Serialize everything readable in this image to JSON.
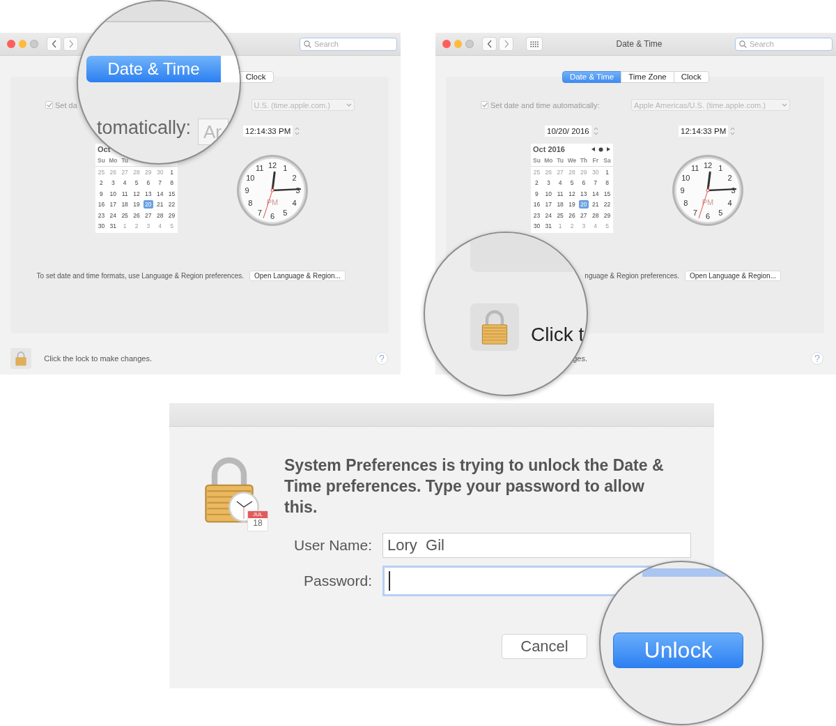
{
  "panels": [
    {
      "grid_button": false,
      "search": {
        "placeholder": "Search"
      },
      "tabs": [
        {
          "label": "Clock",
          "selected": false
        }
      ],
      "auto_set": {
        "checked": true,
        "label": "Set da",
        "server": "U.S. (time.apple.com.)"
      },
      "time": "12:14:33 PM",
      "calendar": {
        "month": "Oct",
        "nav": false,
        "weekdays": [
          "Su",
          "Mo",
          "Tu"
        ],
        "days": [
          {
            "day": "25",
            "outside": true,
            "selected": false
          },
          {
            "day": "26",
            "outside": true,
            "selected": false
          },
          {
            "day": "27",
            "outside": true,
            "selected": false
          },
          {
            "day": "28",
            "outside": true,
            "selected": false
          },
          {
            "day": "29",
            "outside": true,
            "selected": false
          },
          {
            "day": "30",
            "outside": true,
            "selected": false
          },
          {
            "day": "1",
            "outside": false,
            "selected": false
          },
          {
            "day": "2",
            "outside": false,
            "selected": false
          },
          {
            "day": "3",
            "outside": false,
            "selected": false
          },
          {
            "day": "4",
            "outside": false,
            "selected": false
          },
          {
            "day": "5",
            "outside": false,
            "selected": false
          },
          {
            "day": "6",
            "outside": false,
            "selected": false
          },
          {
            "day": "7",
            "outside": false,
            "selected": false
          },
          {
            "day": "8",
            "outside": false,
            "selected": false
          },
          {
            "day": "9",
            "outside": false,
            "selected": false
          },
          {
            "day": "10",
            "outside": false,
            "selected": false
          },
          {
            "day": "11",
            "outside": false,
            "selected": false
          },
          {
            "day": "12",
            "outside": false,
            "selected": false
          },
          {
            "day": "13",
            "outside": false,
            "selected": false
          },
          {
            "day": "14",
            "outside": false,
            "selected": false
          },
          {
            "day": "15",
            "outside": false,
            "selected": false
          },
          {
            "day": "16",
            "outside": false,
            "selected": false
          },
          {
            "day": "17",
            "outside": false,
            "selected": false
          },
          {
            "day": "18",
            "outside": false,
            "selected": false
          },
          {
            "day": "19",
            "outside": false,
            "selected": false
          },
          {
            "day": "20",
            "outside": false,
            "selected": true
          },
          {
            "day": "21",
            "outside": false,
            "selected": false
          },
          {
            "day": "22",
            "outside": false,
            "selected": false
          },
          {
            "day": "23",
            "outside": false,
            "selected": false
          },
          {
            "day": "24",
            "outside": false,
            "selected": false
          },
          {
            "day": "25",
            "outside": false,
            "selected": false
          },
          {
            "day": "26",
            "outside": false,
            "selected": false
          },
          {
            "day": "27",
            "outside": false,
            "selected": false
          },
          {
            "day": "28",
            "outside": false,
            "selected": false
          },
          {
            "day": "29",
            "outside": false,
            "selected": false
          },
          {
            "day": "30",
            "outside": false,
            "selected": false
          },
          {
            "day": "31",
            "outside": false,
            "selected": false
          },
          {
            "day": "1",
            "outside": true,
            "selected": false
          },
          {
            "day": "2",
            "outside": true,
            "selected": false
          },
          {
            "day": "3",
            "outside": true,
            "selected": false
          },
          {
            "day": "4",
            "outside": true,
            "selected": false
          },
          {
            "day": "5",
            "outside": true,
            "selected": false
          }
        ]
      },
      "clock": {
        "numerals": [
          "12",
          "11",
          "1",
          "10",
          "2",
          "9",
          "3",
          "8",
          "4",
          "7",
          "5",
          "6"
        ],
        "meridiem": "PM"
      },
      "format_note": "To set date and time formats, use Language & Region preferences.",
      "format_button": "Open Language & Region...",
      "lock_button": true,
      "lock_note": "Click the lock to make changes.",
      "magnifier": {
        "kind": "tabs",
        "tab": {
          "label": "Date & Time",
          "selected": true
        },
        "label": "tomatically:",
        "field_value": "Ar"
      }
    },
    {
      "grid_button": true,
      "title": "Date & Time",
      "search": {
        "placeholder": "Search"
      },
      "tabs": [
        {
          "label": "Date & Time",
          "selected": true
        },
        {
          "label": "Time Zone",
          "selected": false
        },
        {
          "label": "Clock",
          "selected": false
        }
      ],
      "auto_set": {
        "checked": true,
        "label": "Set date and time automatically:",
        "server": "Apple Americas/U.S. (time.apple.com.)"
      },
      "date": "10/20/ 2016",
      "time": "12:14:33 PM",
      "calendar": {
        "month": "Oct 2016",
        "nav": true,
        "weekdays": [
          "Su",
          "Mo",
          "Tu",
          "We",
          "Th",
          "Fr",
          "Sa"
        ],
        "days": [
          {
            "day": "25",
            "outside": true,
            "selected": false
          },
          {
            "day": "26",
            "outside": true,
            "selected": false
          },
          {
            "day": "27",
            "outside": true,
            "selected": false
          },
          {
            "day": "28",
            "outside": true,
            "selected": false
          },
          {
            "day": "29",
            "outside": true,
            "selected": false
          },
          {
            "day": "30",
            "outside": true,
            "selected": false
          },
          {
            "day": "1",
            "outside": false,
            "selected": false
          },
          {
            "day": "2",
            "outside": false,
            "selected": false
          },
          {
            "day": "3",
            "outside": false,
            "selected": false
          },
          {
            "day": "4",
            "outside": false,
            "selected": false
          },
          {
            "day": "5",
            "outside": false,
            "selected": false
          },
          {
            "day": "6",
            "outside": false,
            "selected": false
          },
          {
            "day": "7",
            "outside": false,
            "selected": false
          },
          {
            "day": "8",
            "outside": false,
            "selected": false
          },
          {
            "day": "9",
            "outside": false,
            "selected": false
          },
          {
            "day": "10",
            "outside": false,
            "selected": false
          },
          {
            "day": "11",
            "outside": false,
            "selected": false
          },
          {
            "day": "12",
            "outside": false,
            "selected": false
          },
          {
            "day": "13",
            "outside": false,
            "selected": false
          },
          {
            "day": "14",
            "outside": false,
            "selected": false
          },
          {
            "day": "15",
            "outside": false,
            "selected": false
          },
          {
            "day": "16",
            "outside": false,
            "selected": false
          },
          {
            "day": "17",
            "outside": false,
            "selected": false
          },
          {
            "day": "18",
            "outside": false,
            "selected": false
          },
          {
            "day": "19",
            "outside": false,
            "selected": false
          },
          {
            "day": "20",
            "outside": false,
            "selected": true
          },
          {
            "day": "21",
            "outside": false,
            "selected": false
          },
          {
            "day": "22",
            "outside": false,
            "selected": false
          },
          {
            "day": "23",
            "outside": false,
            "selected": false
          },
          {
            "day": "24",
            "outside": false,
            "selected": false
          },
          {
            "day": "25",
            "outside": false,
            "selected": false
          },
          {
            "day": "26",
            "outside": false,
            "selected": false
          },
          {
            "day": "27",
            "outside": false,
            "selected": false
          },
          {
            "day": "28",
            "outside": false,
            "selected": false
          },
          {
            "day": "29",
            "outside": false,
            "selected": false
          },
          {
            "day": "30",
            "outside": false,
            "selected": false
          },
          {
            "day": "31",
            "outside": false,
            "selected": false
          },
          {
            "day": "1",
            "outside": true,
            "selected": false
          },
          {
            "day": "2",
            "outside": true,
            "selected": false
          },
          {
            "day": "3",
            "outside": true,
            "selected": false
          },
          {
            "day": "4",
            "outside": true,
            "selected": false
          },
          {
            "day": "5",
            "outside": true,
            "selected": false
          }
        ]
      },
      "clock": {
        "numerals": [
          "12",
          "11",
          "1",
          "10",
          "2",
          "9",
          "3",
          "8",
          "4",
          "7",
          "5",
          "6"
        ],
        "meridiem": "PM"
      },
      "format_note": "nguage & Region preferences.",
      "format_button": "Open Language & Region...",
      "lock_button": false,
      "lock_note": "ges.",
      "magnifier": {
        "kind": "lock",
        "text": "Click t"
      }
    }
  ],
  "dialog": {
    "message": "System Preferences is trying to unlock the Date & Time preferences. Type your password to allow this.",
    "badge_month": "JUL",
    "badge_day": "18",
    "fields": [
      {
        "label": "User Name:",
        "value": "Lory  Gil",
        "focused": false
      },
      {
        "label": "Password:",
        "focused": true
      }
    ],
    "buttons": [
      {
        "label": "Cancel"
      }
    ],
    "magnifier": {
      "kind": "button",
      "button": "Unlock"
    }
  }
}
